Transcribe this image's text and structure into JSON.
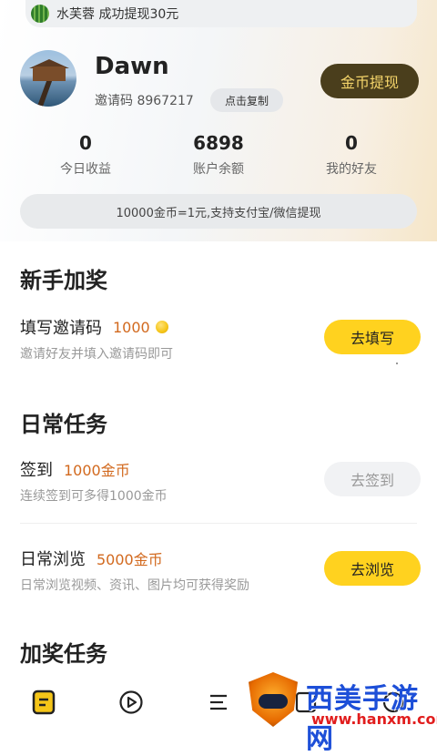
{
  "ticker": {
    "text": "水芙蓉 成功提现30元"
  },
  "profile": {
    "username": "Dawn",
    "invite_text": "邀请码 8967217",
    "copy_label": "点击复制",
    "withdraw_label": "金币提现"
  },
  "stats": [
    {
      "value": "0",
      "label": "今日收益"
    },
    {
      "value": "6898",
      "label": "账户余额"
    },
    {
      "value": "0",
      "label": "我的好友"
    }
  ],
  "banner": {
    "text": "10000金币=1元,支持支付宝/微信提现"
  },
  "newbie": {
    "title": "新手加奖",
    "task": {
      "name": "填写邀请码",
      "reward": "1000",
      "desc": "邀请好友并填入邀请码即可",
      "button": "去填写"
    }
  },
  "daily": {
    "title": "日常任务",
    "tasks": [
      {
        "name": "签到",
        "reward": "1000金币",
        "desc": "连续签到可多得1000金币",
        "button": "去签到"
      },
      {
        "name": "日常浏览",
        "reward": "5000金币",
        "desc": "日常浏览视频、资讯、图片均可获得奖励",
        "button": "去浏览"
      }
    ]
  },
  "bonus": {
    "title": "加奖任务"
  },
  "tabbar": {
    "icons": [
      "task-icon",
      "play-icon",
      "menu-icon",
      "square-icon",
      "circle-icon"
    ],
    "accent": "#f5c518"
  },
  "watermark": {
    "title": "西美手游网",
    "url": "www.hanxm.com"
  },
  "colors": {
    "yellow": "#ffd21f",
    "reward": "#d2691e",
    "withdraw_bg": "#4a3e1c",
    "withdraw_text": "#f4d46a"
  }
}
